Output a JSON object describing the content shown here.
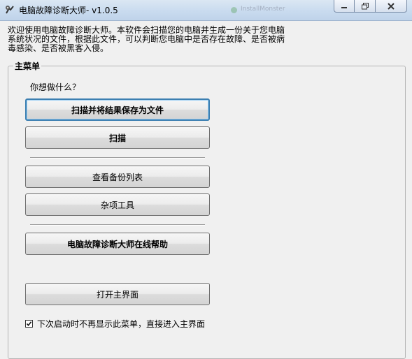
{
  "window": {
    "title": "电脑故障诊断大师- v1.0.5",
    "background_tab_text": "InstallMonster",
    "controls": [
      "minimize-icon",
      "restore-icon",
      "close-icon"
    ]
  },
  "intro": {
    "text": "欢迎使用电脑故障诊断大师。本软件会扫描您的电脑并生成一份关于您电脑\n系统状况的文件，根据此文件，可以判断您电脑中是否存在故障、是否被病\n毒感染、是否被黑客入侵。"
  },
  "main_menu": {
    "title": "主菜单",
    "question": "你想做什么？",
    "buttons": {
      "scan_save": "扫描并将结果保存为文件",
      "scan": "扫描",
      "view_backups": "查看备份列表",
      "misc_tools": "杂项工具",
      "online_help": "电脑故障诊断大师在线帮助",
      "open_main": "打开主界面"
    },
    "checkbox": {
      "label": "下次启动时不再显示此菜单，直接进入主界面",
      "checked": true
    }
  },
  "colors": {
    "default_button_border": "#3c7fb1",
    "titlebar": "#c9dbef"
  }
}
